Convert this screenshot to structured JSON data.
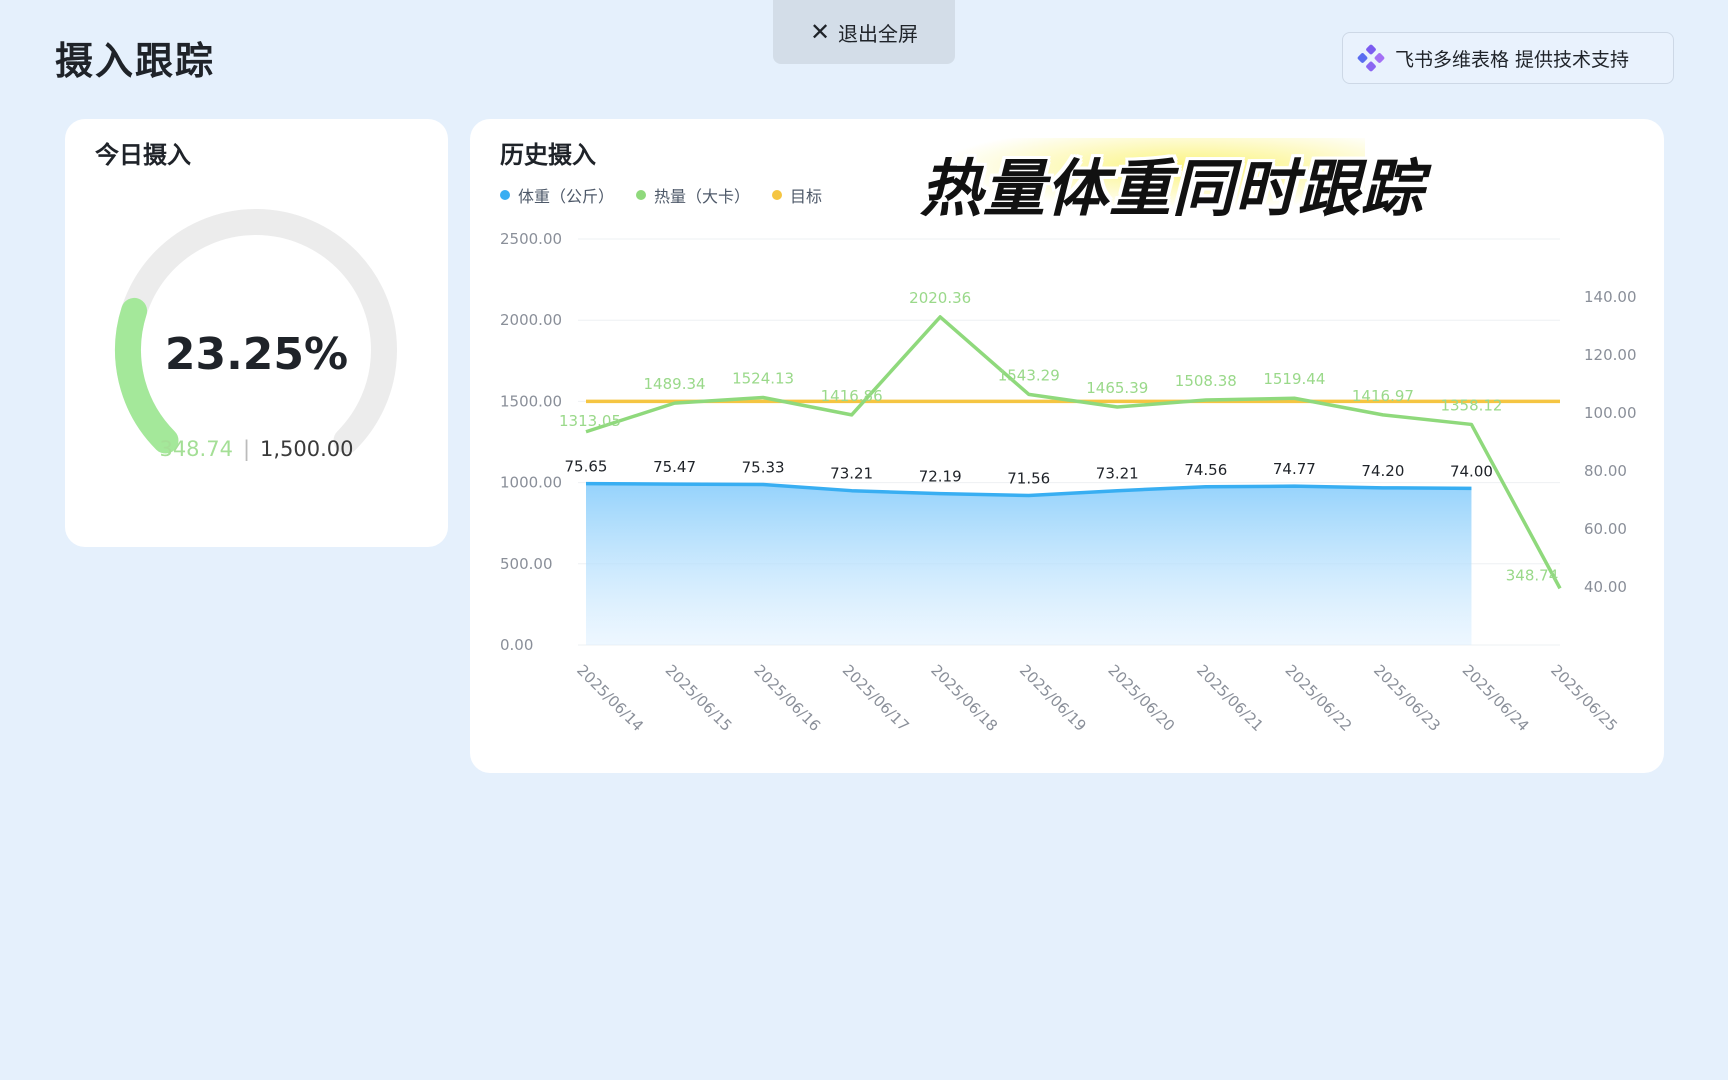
{
  "page": {
    "title": "摄入跟踪"
  },
  "exit_button": {
    "label": "退出全屏"
  },
  "brand": {
    "label": "飞书多维表格 提供技术支持"
  },
  "today_card": {
    "title": "今日摄入",
    "percent": 0.2325,
    "percent_label": "23.25%",
    "current": "348.74",
    "target": "1,500.00"
  },
  "history_card": {
    "title": "历史摄入",
    "overlay_text": "热量体重同时跟踪"
  },
  "colors": {
    "weight": "#38aef2",
    "calories": "#8fd97c",
    "target": "#f5c542",
    "gauge_fill": "#a4e89a",
    "gauge_track": "#ececec"
  },
  "chart_data": {
    "type": "line",
    "categories": [
      "2025/06/14",
      "2025/06/15",
      "2025/06/16",
      "2025/06/17",
      "2025/06/18",
      "2025/06/19",
      "2025/06/20",
      "2025/06/21",
      "2025/06/22",
      "2025/06/23",
      "2025/06/24",
      "2025/06/25"
    ],
    "series": [
      {
        "name": "体重（公斤）",
        "axis": "right",
        "kind": "area",
        "values": [
          75.65,
          75.47,
          75.33,
          73.21,
          72.19,
          71.56,
          73.21,
          74.56,
          74.77,
          74.2,
          74.0,
          null
        ],
        "labels": [
          "75.65",
          "75.47",
          "75.33",
          "73.21",
          "72.19",
          "71.56",
          "73.21",
          "74.56",
          "74.77",
          "74.20",
          "74.00",
          ""
        ]
      },
      {
        "name": "热量（大卡）",
        "axis": "left",
        "kind": "line",
        "values": [
          1313.05,
          1489.34,
          1524.13,
          1416.86,
          2020.36,
          1543.29,
          1465.39,
          1508.38,
          1519.44,
          1416.97,
          1358.12,
          348.74
        ],
        "labels": [
          "1313.05",
          "1489.34",
          "1524.13",
          "1416.86",
          "2020.36",
          "1543.29",
          "1465.39",
          "1508.38",
          "1519.44",
          "1416.97",
          "1358.12",
          "348.74"
        ]
      },
      {
        "name": "目标",
        "axis": "left",
        "kind": "line",
        "values": [
          1500,
          1500,
          1500,
          1500,
          1500,
          1500,
          1500,
          1500,
          1500,
          1500,
          1500,
          1500
        ]
      }
    ],
    "y_left": {
      "min": 0,
      "max": 2500,
      "ticks": [
        "0.00",
        "500.00",
        "1000.00",
        "1500.00",
        "2000.00",
        "2500.00"
      ]
    },
    "y_right": {
      "min": 20,
      "max": 160,
      "ticks": [
        "40.00",
        "60.00",
        "80.00",
        "100.00",
        "120.00",
        "140.00"
      ]
    },
    "grid": true,
    "legend_position": "top-left"
  }
}
